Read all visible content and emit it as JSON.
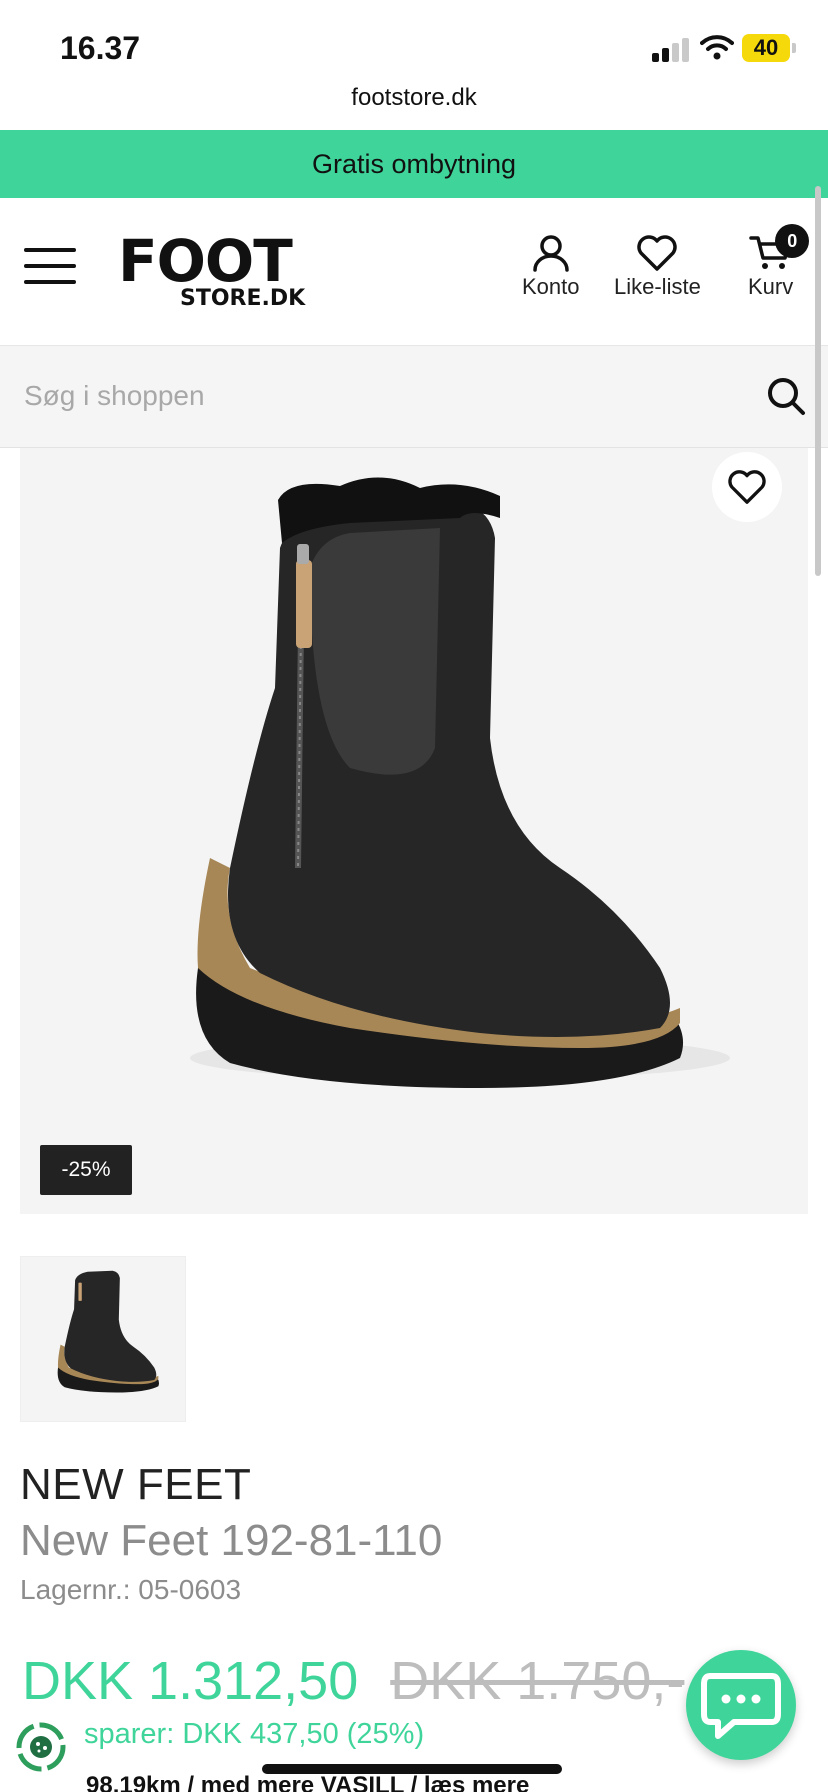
{
  "status_bar": {
    "time": "16.37",
    "battery": "40"
  },
  "browser": {
    "url": "footstore.dk"
  },
  "promo": {
    "text": "Gratis ombytning"
  },
  "header": {
    "logo_top": "FOOT",
    "logo_bottom": "STORE.DK",
    "account_label": "Konto",
    "wishlist_label": "Like-liste",
    "cart_label": "Kurv",
    "cart_count": "0"
  },
  "search": {
    "placeholder": "Søg i shoppen"
  },
  "product": {
    "discount_badge": "-25%",
    "brand": "NEW FEET",
    "name": "New Feet 192-81-110",
    "sku": "Lagernr.: 05-0603",
    "price_now": "DKK 1.312,50",
    "price_old": "DKK 1.750,-",
    "savings": "sparer: DKK 437,50 (25%)",
    "footer_peek": "98.19km  / med mere  VASILL  / læs mere"
  },
  "colors": {
    "accent": "#3fd59a",
    "dark": "#111111",
    "muted": "#8c8c8c"
  },
  "icons": [
    "hamburger-icon",
    "user-icon",
    "heart-icon",
    "cart-icon",
    "search-icon",
    "chat-icon",
    "cookie-icon"
  ]
}
